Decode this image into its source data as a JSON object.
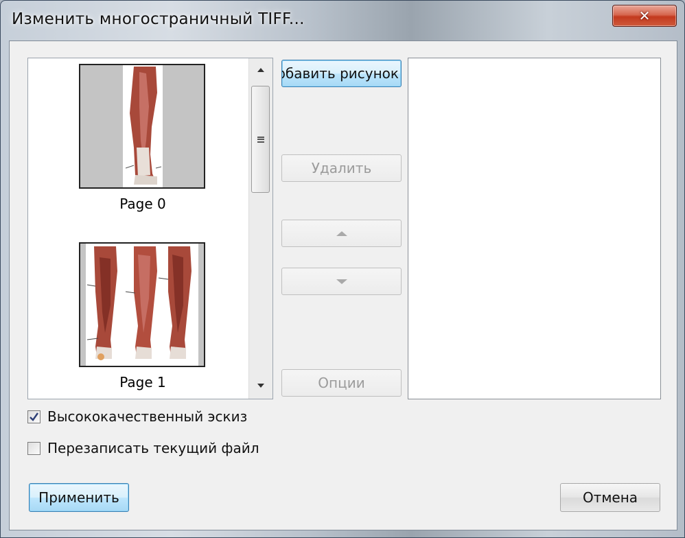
{
  "window": {
    "title": "Изменить многостраничный TIFF...",
    "close_symbol": "✕"
  },
  "pages": [
    {
      "label": "Page 0"
    },
    {
      "label": "Page 1"
    }
  ],
  "buttons": {
    "add": "рбавить рисунок",
    "delete": "Удалить",
    "move_up_icon": "triangle-up-icon",
    "move_down_icon": "triangle-down-icon",
    "options": "Опции",
    "apply": "Применить",
    "cancel": "Отмена"
  },
  "checkboxes": [
    {
      "label": "Высококачественный эскиз",
      "checked": true
    },
    {
      "label": "Перезаписать текущий файл",
      "checked": false
    }
  ],
  "colors": {
    "close_button": "#c3391e",
    "focus_blue": "#3c7fb1",
    "muscle": "#a8493a"
  }
}
